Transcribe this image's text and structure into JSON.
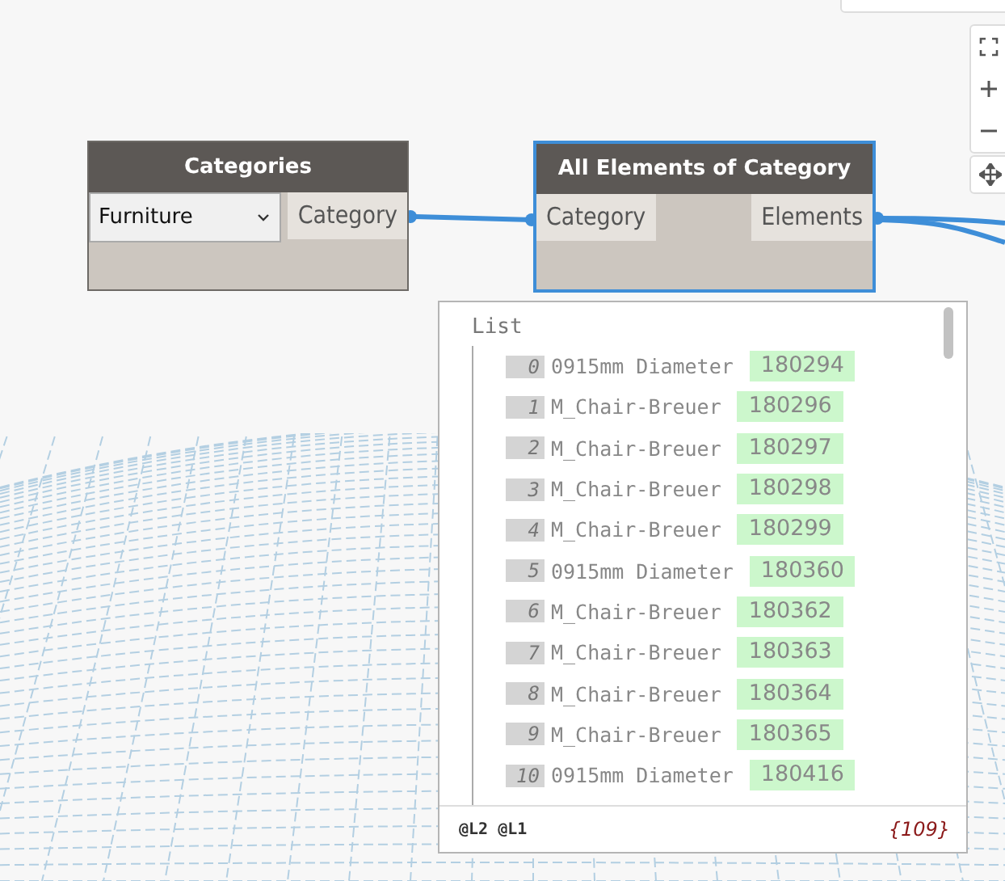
{
  "nodes": [
    {
      "title": "Categories",
      "selected": false,
      "dropdown": {
        "value": "Furniture"
      },
      "outputs": [
        "Category"
      ]
    },
    {
      "title": "All Elements of Category",
      "selected": true,
      "inputs": [
        "Category"
      ],
      "outputs": [
        "Elements"
      ]
    }
  ],
  "preview": {
    "title": "List",
    "items": [
      {
        "index": "0",
        "name": "0915mm Diameter",
        "value": "180294"
      },
      {
        "index": "1",
        "name": "M_Chair-Breuer",
        "value": "180296"
      },
      {
        "index": "2",
        "name": "M_Chair-Breuer",
        "value": "180297"
      },
      {
        "index": "3",
        "name": "M_Chair-Breuer",
        "value": "180298"
      },
      {
        "index": "4",
        "name": "M_Chair-Breuer",
        "value": "180299"
      },
      {
        "index": "5",
        "name": "0915mm Diameter",
        "value": "180360"
      },
      {
        "index": "6",
        "name": "M_Chair-Breuer",
        "value": "180362"
      },
      {
        "index": "7",
        "name": "M_Chair-Breuer",
        "value": "180363"
      },
      {
        "index": "8",
        "name": "M_Chair-Breuer",
        "value": "180364"
      },
      {
        "index": "9",
        "name": "M_Chair-Breuer",
        "value": "180365"
      },
      {
        "index": "10",
        "name": "0915mm Diameter",
        "value": "180416"
      }
    ],
    "levels": "@L2 @L1",
    "count": "{109}"
  }
}
